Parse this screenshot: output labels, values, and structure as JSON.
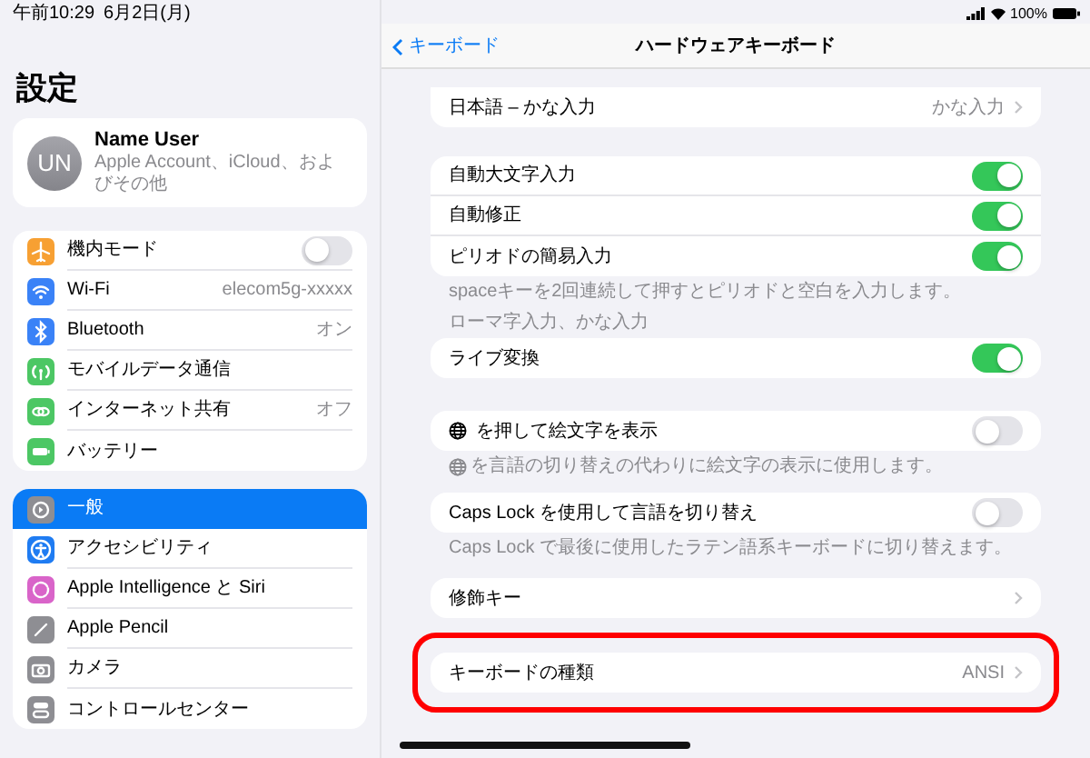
{
  "status_bar": {
    "time": "午前10:29",
    "date": "6月2日(月)",
    "battery": "100%"
  },
  "sidebar": {
    "title": "設定",
    "account": {
      "initials": "UN",
      "name": "Name User",
      "subtitle": "Apple Account、iCloud、およびその他"
    },
    "groups": [
      {
        "items": [
          {
            "label": "機内モード",
            "kind": "toggle",
            "on": false,
            "color": "#f7a033",
            "selected": false
          },
          {
            "label": "Wi-Fi",
            "kind": "value",
            "value": "elecom5g-xxxxx",
            "color": "#3a82f7",
            "selected": false
          },
          {
            "label": "Bluetooth",
            "kind": "value",
            "value": "オン",
            "color": "#3a82f7",
            "selected": false
          },
          {
            "label": "モバイルデータ通信",
            "kind": "link",
            "color": "#4cc764",
            "selected": false
          },
          {
            "label": "インターネット共有",
            "kind": "value",
            "value": "オフ",
            "color": "#4cc764",
            "selected": false
          },
          {
            "label": "バッテリー",
            "kind": "link",
            "color": "#4cc764",
            "selected": false
          }
        ]
      },
      {
        "items": [
          {
            "label": "一般",
            "kind": "link",
            "color": "#8e8e93",
            "selected": true
          },
          {
            "label": "アクセシビリティ",
            "kind": "link",
            "color": "#1f7cf2",
            "selected": false
          },
          {
            "label": "Apple Intelligence と Siri",
            "kind": "link",
            "color": "#d964c9",
            "selected": false
          },
          {
            "label": "Apple Pencil",
            "kind": "link",
            "color": "#8e8e93",
            "selected": false
          },
          {
            "label": "カメラ",
            "kind": "link",
            "color": "#8e8e93",
            "selected": false
          },
          {
            "label": "コントロールセンター",
            "kind": "link",
            "color": "#8e8e93",
            "selected": false
          }
        ]
      }
    ]
  },
  "detail": {
    "back": "キーボード",
    "title": "ハードウェアキーボード",
    "groups": [
      {
        "rows": [
          {
            "label": "日本語 – かな入力",
            "kind": "value",
            "value": "かな入力"
          }
        ]
      },
      {
        "rows": [
          {
            "label": "自動大文字入力",
            "kind": "toggle",
            "on": true
          },
          {
            "label": "自動修正",
            "kind": "toggle",
            "on": true
          },
          {
            "label": "ピリオドの簡易入力",
            "kind": "toggle",
            "on": true
          }
        ],
        "footer": {
          "text": "spaceキーを2回連続して押すとピリオドと空白を入力します。",
          "globe": false
        }
      },
      {
        "header": "ローマ字入力、かな入力",
        "rows": [
          {
            "label": "ライブ変換",
            "kind": "toggle",
            "on": true
          }
        ]
      },
      {
        "rows": [
          {
            "label": "を押して絵文字を表示",
            "kind": "toggle",
            "on": false,
            "globe": true
          }
        ],
        "footer": {
          "text": "を言語の切り替えの代わりに絵文字の表示に使用します。",
          "globe": true
        }
      },
      {
        "rows": [
          {
            "label": "Caps Lock を使用して言語を切り替え",
            "kind": "toggle",
            "on": false
          }
        ],
        "footer": {
          "text": "Caps Lock で最後に使用したラテン語系キーボードに切り替えます。",
          "globe": false
        }
      },
      {
        "rows": [
          {
            "label": "修飾キー",
            "kind": "link"
          }
        ]
      },
      {
        "rows": [
          {
            "label": "キーボードの種類",
            "kind": "value",
            "value": "ANSI"
          }
        ],
        "highlighted": true
      }
    ]
  }
}
